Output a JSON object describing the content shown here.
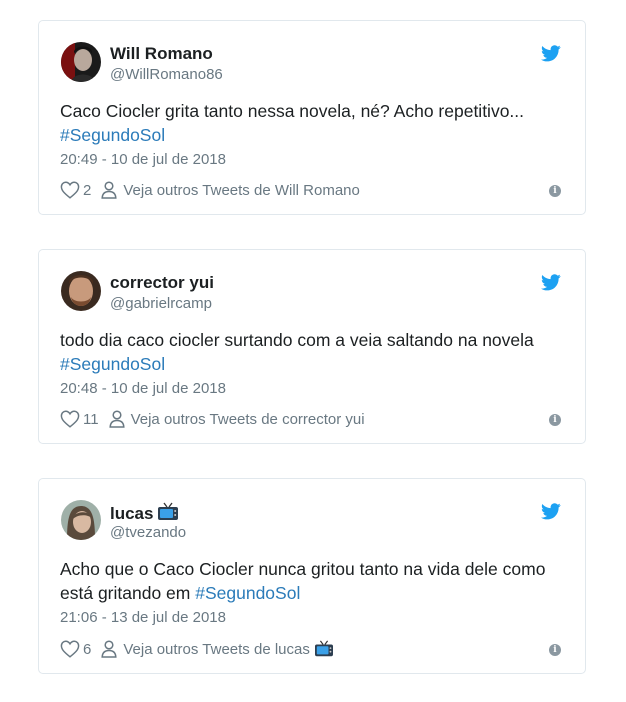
{
  "colors": {
    "twitter_blue": "#1da1f2",
    "hashtag": "#2b7bb9",
    "muted": "#697882",
    "border": "#e1e8ed"
  },
  "tweets": [
    {
      "name": "Will Romano",
      "handle": "@WillRomano86",
      "text_before": "Caco Ciocler grita tanto nessa novela, né? Acho repetitivo...",
      "hashtag": "#SegundoSol",
      "timestamp": "20:49 - 10 de jul de 2018",
      "likes": "2",
      "more_tweets": "Veja outros Tweets de Will Romano"
    },
    {
      "name": "corrector yui",
      "handle": "@gabrielrcamp",
      "text_before": "todo dia caco ciocler surtando com a veia saltando na novela",
      "hashtag": "#SegundoSol",
      "timestamp": "20:48 - 10 de jul de 2018",
      "likes": "11",
      "more_tweets": "Veja outros Tweets de corrector yui"
    },
    {
      "name": "lucas",
      "handle": "@tvezando",
      "text_before": "Acho que o Caco Ciocler nunca gritou tanto na vida dele como está gritando em",
      "hashtag": "#SegundoSol",
      "timestamp": "21:06 - 13 de jul de 2018",
      "likes": "6",
      "more_tweets": "Veja outros Tweets de lucas"
    }
  ],
  "icons": {
    "bird": "twitter-bird-icon",
    "heart": "heart-icon",
    "person": "person-icon",
    "info": "info-icon",
    "tv": "television-emoji-icon"
  }
}
